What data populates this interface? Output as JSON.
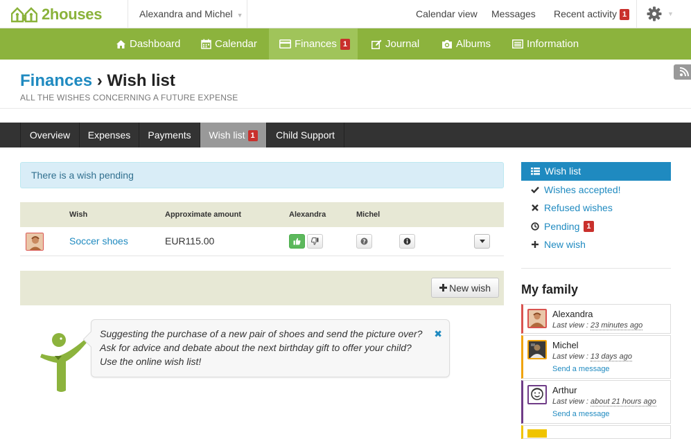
{
  "brand": {
    "name": "2houses",
    "color": "#8cb33d",
    "link_color": "#1f8ac0"
  },
  "topbar": {
    "family": "Alexandra and Michel",
    "links": {
      "calendar_view": "Calendar view",
      "messages": "Messages",
      "recent_activity": "Recent activity",
      "recent_activity_count": "1"
    }
  },
  "nav": {
    "items": [
      {
        "label": "Dashboard",
        "icon": "home-icon"
      },
      {
        "label": "Calendar",
        "icon": "calendar-icon"
      },
      {
        "label": "Finances",
        "icon": "credit-card-icon",
        "badge": "1",
        "active": true
      },
      {
        "label": "Journal",
        "icon": "edit-icon"
      },
      {
        "label": "Albums",
        "icon": "camera-icon"
      },
      {
        "label": "Information",
        "icon": "list-icon"
      }
    ]
  },
  "page": {
    "crumb": "Finances",
    "separator": " › ",
    "title": "Wish list",
    "subtitle": "ALL THE WISHES CONCERNING A FUTURE EXPENSE"
  },
  "subnav": {
    "tabs": [
      {
        "label": "Overview"
      },
      {
        "label": "Expenses"
      },
      {
        "label": "Payments"
      },
      {
        "label": "Wish list",
        "badge": "1",
        "active": true
      },
      {
        "label": "Child Support"
      }
    ]
  },
  "alert": {
    "text": "There is a wish pending"
  },
  "table": {
    "headers": {
      "wish": "Wish",
      "amount": "Approximate amount",
      "parent1": "Alexandra",
      "parent2": "Michel"
    },
    "rows": [
      {
        "wish": "Soccer shoes",
        "amount": "EUR115.00",
        "alexandra_vote": "approved",
        "michel_vote": "pending"
      }
    ]
  },
  "actions": {
    "new_wish": "New wish"
  },
  "tip": {
    "lines": [
      "Suggesting the purchase of a new pair of shoes and send the picture over?",
      "Ask for advice and debate about the next birthday gift to offer your child?",
      "Use the online wish list!"
    ]
  },
  "sidebar": {
    "items": [
      {
        "label": "Wish list",
        "icon": "list-icon",
        "active": true
      },
      {
        "label": "Wishes accepted!",
        "icon": "check-icon"
      },
      {
        "label": "Refused wishes",
        "icon": "x-icon"
      },
      {
        "label": "Pending",
        "icon": "clock-icon",
        "badge": "1"
      },
      {
        "label": "New wish",
        "icon": "plus-icon"
      }
    ]
  },
  "family": {
    "title": "My family",
    "members": [
      {
        "name": "Alexandra",
        "last_view_label": "Last view :",
        "last_view": "23 minutes ago",
        "color": "#d9534f"
      },
      {
        "name": "Michel",
        "last_view_label": "Last view :",
        "last_view": "13 days ago",
        "send": "Send a message",
        "color": "#f0a30a"
      },
      {
        "name": "Arthur",
        "last_view_label": "Last view :",
        "last_view": "about 21 hours ago",
        "send": "Send a message",
        "color": "#6f3c87"
      }
    ]
  }
}
